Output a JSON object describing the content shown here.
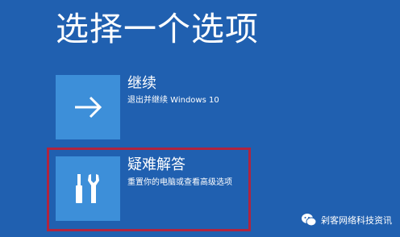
{
  "page": {
    "title": "选择一个选项"
  },
  "options": [
    {
      "title": "继续",
      "description": "退出并继续 Windows 10",
      "icon": "arrow-right-icon"
    },
    {
      "title": "疑难解答",
      "description": "重置你的电脑或查看高级选项",
      "icon": "tools-icon"
    }
  ],
  "watermark": {
    "text": "剁客网络科技资讯",
    "logo": "wechat-logo"
  },
  "colors": {
    "background": "#2060b0",
    "tile": "#3d8fd9",
    "highlight": "#b0243f",
    "text": "#ffffff"
  }
}
